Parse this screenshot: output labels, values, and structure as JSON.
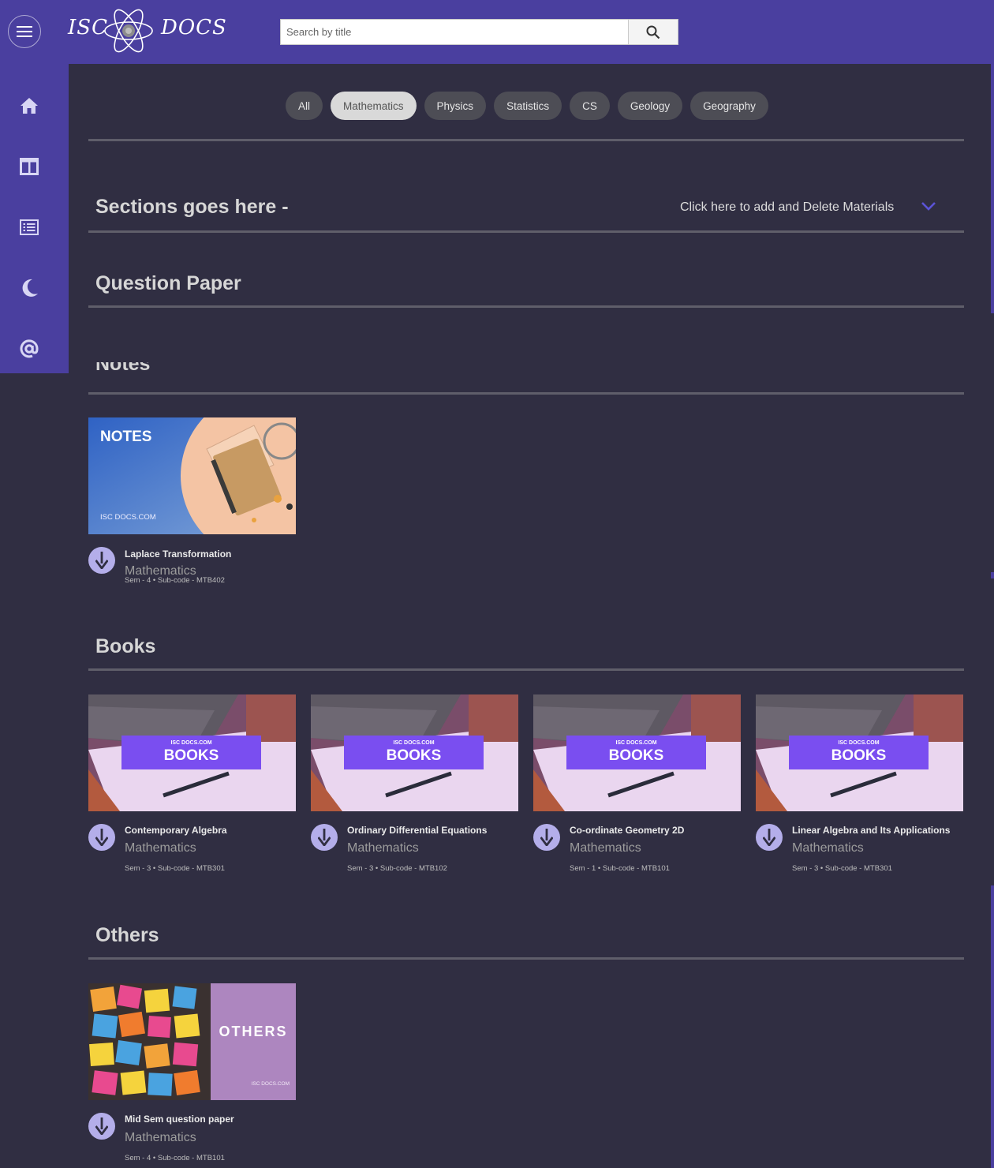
{
  "header": {
    "logo_left": "ISC",
    "logo_right": "DOCS",
    "search_placeholder": "Search by title",
    "search_icon": "search-icon",
    "menu_icon": "hamburger-icon"
  },
  "sidebar": {
    "items": [
      {
        "icon": "home-icon"
      },
      {
        "icon": "grid-icon"
      },
      {
        "icon": "list-icon"
      },
      {
        "icon": "moon-icon"
      },
      {
        "icon": "at-icon"
      }
    ]
  },
  "filters": [
    "All",
    "Mathematics",
    "Physics",
    "Statistics",
    "CS",
    "Geology",
    "Geography"
  ],
  "active_filter": "Mathematics",
  "sections_heading": "Sections goes here -",
  "add_delete_label": "Click here to add and Delete Materials",
  "question_paper_title": "Question Paper",
  "notes_title": "Notes",
  "notes": [
    {
      "thumb_label": "NOTES",
      "thumb_brand": "ISC DOCS.COM",
      "title": "Laplace Transformation",
      "subject": "Mathematics",
      "sem": "Sem - 4",
      "code": "Sub-code - MTB402"
    }
  ],
  "books_title": "Books",
  "books": [
    {
      "thumb_brand": "ISC DOCS.COM",
      "thumb_label": "BOOKS",
      "title": "Contemporary Algebra",
      "subject": "Mathematics",
      "sem": "Sem - 3",
      "code": "Sub-code - MTB301"
    },
    {
      "thumb_brand": "ISC DOCS.COM",
      "thumb_label": "BOOKS",
      "title": "Ordinary Differential Equations",
      "subject": "Mathematics",
      "sem": "Sem - 3",
      "code": "Sub-code - MTB102"
    },
    {
      "thumb_brand": "ISC DOCS.COM",
      "thumb_label": "BOOKS",
      "title": "Co-ordinate Geometry 2D",
      "subject": "Mathematics",
      "sem": "Sem - 1",
      "code": "Sub-code - MTB101"
    },
    {
      "thumb_brand": "ISC DOCS.COM",
      "thumb_label": "BOOKS",
      "title": "Linear Algebra and Its Applications",
      "subject": "Mathematics",
      "sem": "Sem - 3",
      "code": "Sub-code - MTB301"
    }
  ],
  "others_title": "Others",
  "others": [
    {
      "thumb_label": "OTHERS",
      "thumb_brand": "ISC DOCS.COM",
      "title": "Mid Sem question paper",
      "subject": "Mathematics",
      "sem": "Sem - 4",
      "code": "Sub-code - MTB101"
    }
  ],
  "colors": {
    "brand": "#4a3f9f",
    "background": "#302e42",
    "pill": "#4d4d55",
    "pill_active": "#d9d9d9",
    "download_icon": "#b4aeea"
  }
}
